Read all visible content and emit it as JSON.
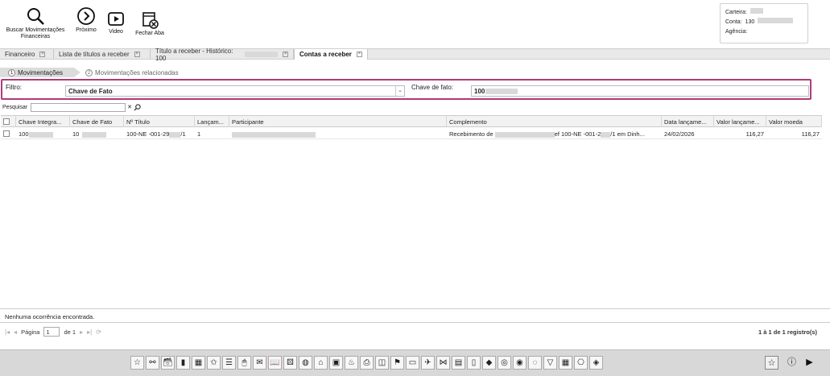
{
  "toolbar": {
    "buscar": "Buscar Movimentações Financeiras",
    "proximo": "Próximo",
    "video": "Video",
    "fechar": "Fechar Aba"
  },
  "account": {
    "carteira_label": "Carteira:",
    "conta_label": "Conta:",
    "conta_value": "130",
    "agencia_label": "Agência:"
  },
  "tabs": [
    {
      "label": "Financeiro"
    },
    {
      "label": "Lista de títulos a receber"
    },
    {
      "label": "Título a receber - Histórico: 100"
    },
    {
      "label": "Contas a receber"
    }
  ],
  "steps": [
    {
      "num": "1",
      "label": "Movimentações"
    },
    {
      "num": "2",
      "label": "Movimentações relacionadas"
    }
  ],
  "filter": {
    "label": "Filtro:",
    "value": "Chave de Fato",
    "chave_label": "Chave de fato:",
    "chave_value": "100"
  },
  "search": {
    "label": "Pesquisar",
    "clear": "✕"
  },
  "table": {
    "headers": [
      "Chave Integra...",
      "Chave de Fato",
      "Nº Título",
      "Lançam...",
      "Participante",
      "Complemento",
      "Data lançame...",
      "Valor lançame...",
      "Valor moeda"
    ],
    "rows": [
      {
        "chave_integra": "100",
        "chave_fato": "10",
        "titulo": "100-NE -001-29",
        "titulo_suffix": "/1",
        "lancamento": "1",
        "participante": "",
        "complemento_a": "Recebimento de",
        "complemento_b": "ef 100-NE -001-2",
        "complemento_c": "/1 em Dinh...",
        "data": "24/02/2026",
        "valor_lancamento": "116,27",
        "valor_moeda": "116,27"
      }
    ]
  },
  "status": "Nenhuma ocorrência encontrada.",
  "pager": {
    "pagina_label": "Página",
    "page": "1",
    "de_label": "de 1",
    "total": "1 à 1 de 1 registro(s)"
  },
  "dock_icons": [
    "☆",
    "⚯",
    "🗃",
    "▮",
    "▦",
    "✩",
    "☰",
    "🖱",
    "✉",
    "📖",
    "⚄",
    "◍",
    "⌂",
    "▣",
    "♨",
    "⎙",
    "◫",
    "⚑",
    "▭",
    "✈",
    "⋈",
    "▤",
    "▯",
    "◆",
    "◎",
    "◉",
    "◌",
    "▽",
    "▦",
    "⎔",
    "◈"
  ]
}
